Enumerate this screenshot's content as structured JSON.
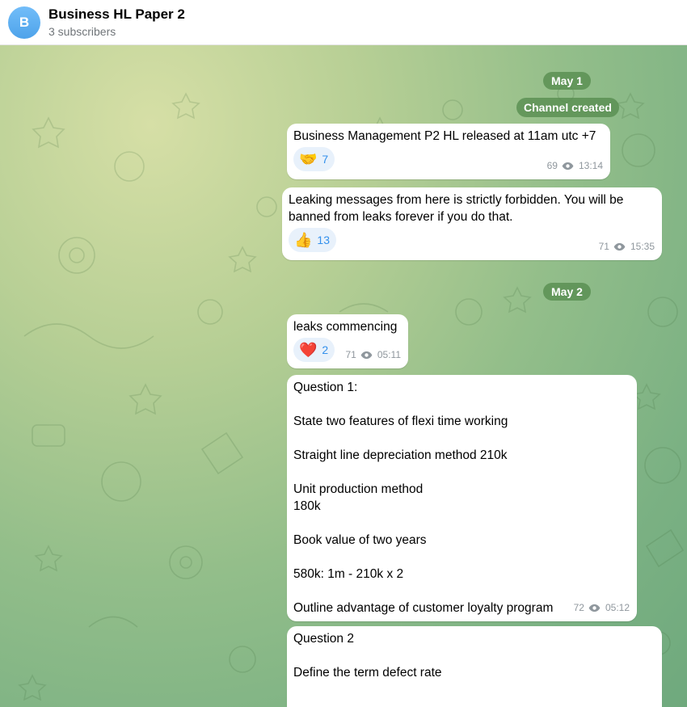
{
  "header": {
    "avatar_letter": "B",
    "title": "Business HL Paper 2",
    "subtitle": "3 subscribers"
  },
  "dates": {
    "may1": "May 1",
    "may2": "May 2"
  },
  "service": {
    "channel_created": "Channel created"
  },
  "messages": [
    {
      "text": "Business Management P2 HL released at 11am utc +7",
      "reaction_emoji": "🤝",
      "reaction_count": "7",
      "views": "69",
      "time": "13:14"
    },
    {
      "text": "Leaking messages from here is strictly forbidden. You will be banned from leaks forever if you do that.",
      "reaction_emoji": "👍",
      "reaction_count": "13",
      "views": "71",
      "time": "15:35"
    },
    {
      "text": "leaks commencing",
      "reaction_emoji": "❤️",
      "reaction_count": "2",
      "views": "71",
      "time": "05:11"
    },
    {
      "text": "Question 1:\n\nState two features of flexi time working\n\nStraight line depreciation method 210k\n\nUnit production method\n180k\n\nBook value of two years\n\n580k: 1m - 210k x 2\n\nOutline advantage of customer loyalty program",
      "views": "72",
      "time": "05:12"
    },
    {
      "text": "Question 2\n\nDefine the term defect rate"
    }
  ],
  "colors": {
    "accent": "#3390ec",
    "bubble": "#ffffff",
    "date_pill": "#568c4e",
    "avatar": "#5caaf0"
  },
  "icons": {
    "views": "eye-icon"
  }
}
